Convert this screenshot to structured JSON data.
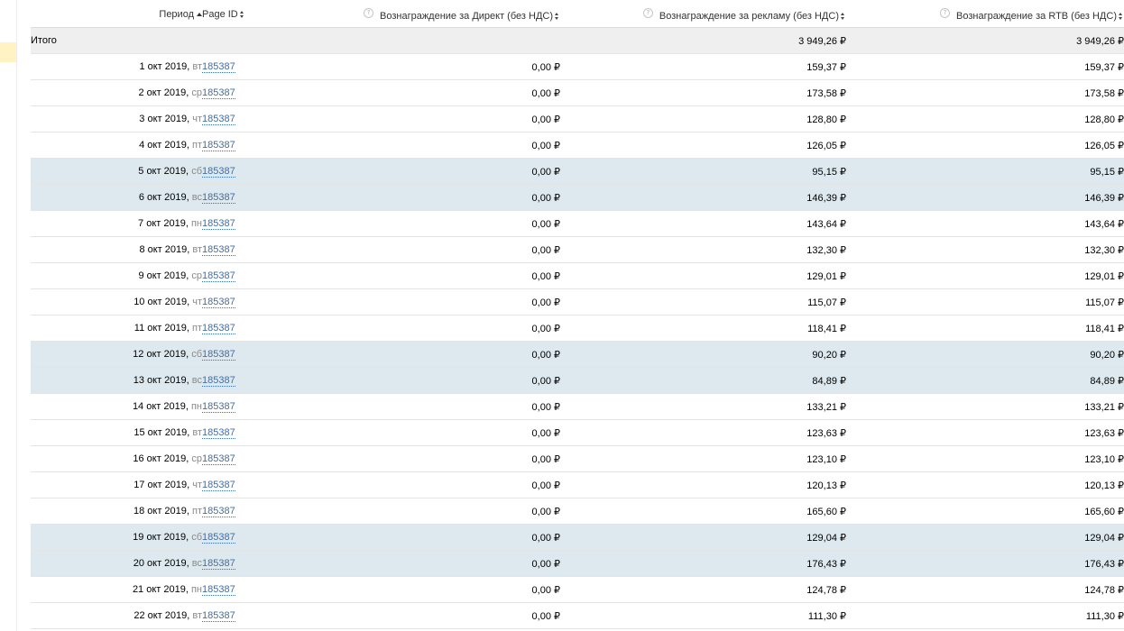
{
  "table": {
    "headers": {
      "period": "Период",
      "page_id": "Page ID",
      "direct": "Вознаграждение за Директ (без НДС)",
      "ads": "Вознаграждение за рекламу (без НДС)",
      "rtb": "Вознаграждение за RTB (без НДС)"
    },
    "help_glyph": "?",
    "total": {
      "label": "Итого",
      "direct": "",
      "ads": "3 949,26 ₽",
      "rtb": "3 949,26 ₽"
    },
    "rows": [
      {
        "date": "1 окт 2019,",
        "dow": "вт",
        "page_id": "185387",
        "direct": "0,00 ₽",
        "ads": "159,37 ₽",
        "rtb": "159,37 ₽",
        "weekend": false
      },
      {
        "date": "2 окт 2019,",
        "dow": "ср",
        "page_id": "185387",
        "direct": "0,00 ₽",
        "ads": "173,58 ₽",
        "rtb": "173,58 ₽",
        "weekend": false
      },
      {
        "date": "3 окт 2019,",
        "dow": "чт",
        "page_id": "185387",
        "direct": "0,00 ₽",
        "ads": "128,80 ₽",
        "rtb": "128,80 ₽",
        "weekend": false
      },
      {
        "date": "4 окт 2019,",
        "dow": "пт",
        "page_id": "185387",
        "direct": "0,00 ₽",
        "ads": "126,05 ₽",
        "rtb": "126,05 ₽",
        "weekend": false
      },
      {
        "date": "5 окт 2019,",
        "dow": "сб",
        "page_id": "185387",
        "direct": "0,00 ₽",
        "ads": "95,15 ₽",
        "rtb": "95,15 ₽",
        "weekend": true
      },
      {
        "date": "6 окт 2019,",
        "dow": "вс",
        "page_id": "185387",
        "direct": "0,00 ₽",
        "ads": "146,39 ₽",
        "rtb": "146,39 ₽",
        "weekend": true
      },
      {
        "date": "7 окт 2019,",
        "dow": "пн",
        "page_id": "185387",
        "direct": "0,00 ₽",
        "ads": "143,64 ₽",
        "rtb": "143,64 ₽",
        "weekend": false
      },
      {
        "date": "8 окт 2019,",
        "dow": "вт",
        "page_id": "185387",
        "direct": "0,00 ₽",
        "ads": "132,30 ₽",
        "rtb": "132,30 ₽",
        "weekend": false
      },
      {
        "date": "9 окт 2019,",
        "dow": "ср",
        "page_id": "185387",
        "direct": "0,00 ₽",
        "ads": "129,01 ₽",
        "rtb": "129,01 ₽",
        "weekend": false
      },
      {
        "date": "10 окт 2019,",
        "dow": "чт",
        "page_id": "185387",
        "direct": "0,00 ₽",
        "ads": "115,07 ₽",
        "rtb": "115,07 ₽",
        "weekend": false
      },
      {
        "date": "11 окт 2019,",
        "dow": "пт",
        "page_id": "185387",
        "direct": "0,00 ₽",
        "ads": "118,41 ₽",
        "rtb": "118,41 ₽",
        "weekend": false
      },
      {
        "date": "12 окт 2019,",
        "dow": "сб",
        "page_id": "185387",
        "direct": "0,00 ₽",
        "ads": "90,20 ₽",
        "rtb": "90,20 ₽",
        "weekend": true
      },
      {
        "date": "13 окт 2019,",
        "dow": "вс",
        "page_id": "185387",
        "direct": "0,00 ₽",
        "ads": "84,89 ₽",
        "rtb": "84,89 ₽",
        "weekend": true
      },
      {
        "date": "14 окт 2019,",
        "dow": "пн",
        "page_id": "185387",
        "direct": "0,00 ₽",
        "ads": "133,21 ₽",
        "rtb": "133,21 ₽",
        "weekend": false
      },
      {
        "date": "15 окт 2019,",
        "dow": "вт",
        "page_id": "185387",
        "direct": "0,00 ₽",
        "ads": "123,63 ₽",
        "rtb": "123,63 ₽",
        "weekend": false
      },
      {
        "date": "16 окт 2019,",
        "dow": "ср",
        "page_id": "185387",
        "direct": "0,00 ₽",
        "ads": "123,10 ₽",
        "rtb": "123,10 ₽",
        "weekend": false
      },
      {
        "date": "17 окт 2019,",
        "dow": "чт",
        "page_id": "185387",
        "direct": "0,00 ₽",
        "ads": "120,13 ₽",
        "rtb": "120,13 ₽",
        "weekend": false
      },
      {
        "date": "18 окт 2019,",
        "dow": "пт",
        "page_id": "185387",
        "direct": "0,00 ₽",
        "ads": "165,60 ₽",
        "rtb": "165,60 ₽",
        "weekend": false
      },
      {
        "date": "19 окт 2019,",
        "dow": "сб",
        "page_id": "185387",
        "direct": "0,00 ₽",
        "ads": "129,04 ₽",
        "rtb": "129,04 ₽",
        "weekend": true
      },
      {
        "date": "20 окт 2019,",
        "dow": "вс",
        "page_id": "185387",
        "direct": "0,00 ₽",
        "ads": "176,43 ₽",
        "rtb": "176,43 ₽",
        "weekend": true
      },
      {
        "date": "21 окт 2019,",
        "dow": "пн",
        "page_id": "185387",
        "direct": "0,00 ₽",
        "ads": "124,78 ₽",
        "rtb": "124,78 ₽",
        "weekend": false
      },
      {
        "date": "22 окт 2019,",
        "dow": "вт",
        "page_id": "185387",
        "direct": "0,00 ₽",
        "ads": "111,30 ₽",
        "rtb": "111,30 ₽",
        "weekend": false
      }
    ]
  },
  "colors": {
    "weekend_row": "#dde9ee",
    "total_row": "#efefef",
    "link": "#3f6ea8",
    "sidebar_marker": "#fff3c4"
  },
  "icons": {
    "sort_active": "sort-ascending-icon",
    "sort_inactive": "sort-toggle-icon",
    "help": "help-icon"
  }
}
